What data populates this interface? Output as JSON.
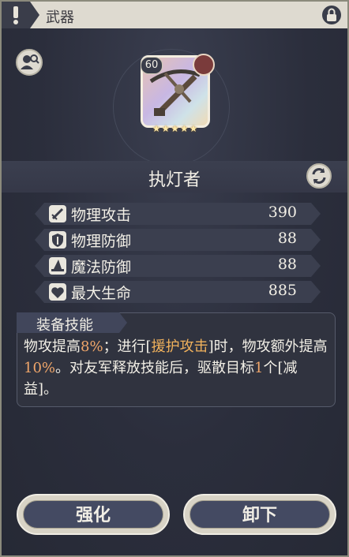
{
  "header": {
    "title": "武器"
  },
  "weapon": {
    "level": "60",
    "stars": "★★★★★",
    "name": "执灯者"
  },
  "stats": [
    {
      "label": "物理攻击",
      "value": "390",
      "icon": "sword-icon"
    },
    {
      "label": "物理防御",
      "value": "88",
      "icon": "shield-icon"
    },
    {
      "label": "魔法防御",
      "value": "88",
      "icon": "witch-hat-icon"
    },
    {
      "label": "最大生命",
      "value": "885",
      "icon": "heart-icon"
    }
  ],
  "skill": {
    "title": "装备技能",
    "p1": "物攻提高",
    "v1": "8%",
    "p2": "；进行[",
    "kw1": "援护攻击",
    "p3": "]时，物攻额外提高",
    "v2": "10%",
    "p4": "。对友军释放技能后，驱散目标",
    "v3": "1",
    "p5": "个[减益]。"
  },
  "buttons": {
    "enhance": "强化",
    "unequip": "卸下"
  },
  "colors": {
    "highlight": "#f0a66a",
    "keyword": "#f1b25c",
    "panel": "#2b2e3c",
    "titlebar": "#dedad0"
  }
}
